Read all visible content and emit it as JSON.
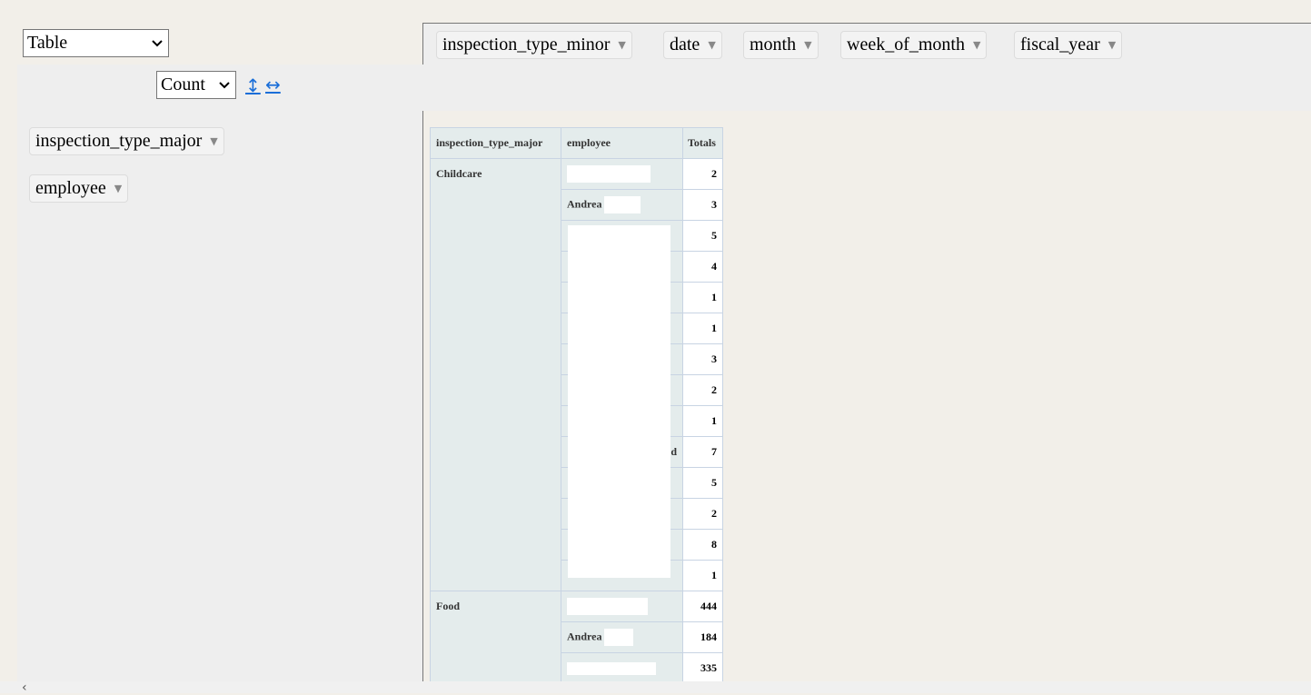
{
  "renderer": {
    "selected": "Table"
  },
  "aggregator": {
    "selected": "Count"
  },
  "sort": {
    "rows_icon": "row-sort-arrows-icon",
    "cols_icon": "col-sort-arrows-icon"
  },
  "col_fields": [
    "inspection_type_minor",
    "date",
    "month",
    "week_of_month",
    "fiscal_year"
  ],
  "row_fields": [
    "inspection_type_major",
    "employee"
  ],
  "table": {
    "header": {
      "major": "inspection_type_major",
      "employee": "employee",
      "totals": "Totals"
    },
    "childcare": {
      "label": "Childcare",
      "rows": [
        {
          "employee": "",
          "total": "2"
        },
        {
          "employee": "Andrea",
          "total": "3"
        },
        {
          "employee": "",
          "total": "5"
        },
        {
          "employee": "",
          "total": "4"
        },
        {
          "employee": "",
          "total": "1"
        },
        {
          "employee": "",
          "total": "1"
        },
        {
          "employee": "",
          "total": "3"
        },
        {
          "employee": "",
          "total": "2"
        },
        {
          "employee": "",
          "total": "1"
        },
        {
          "employee": "d",
          "total": "7"
        },
        {
          "employee": "",
          "total": "5"
        },
        {
          "employee": "",
          "total": "2"
        },
        {
          "employee": "",
          "total": "8"
        },
        {
          "employee": "",
          "total": "1"
        }
      ]
    },
    "food": {
      "label": "Food",
      "rows": [
        {
          "employee": "",
          "total": "444"
        },
        {
          "employee": "Andrea",
          "total": "184"
        },
        {
          "employee": "",
          "total": "335"
        }
      ]
    }
  }
}
